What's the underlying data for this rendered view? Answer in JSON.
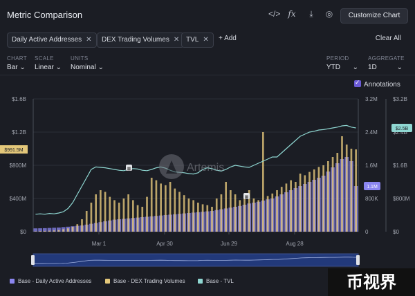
{
  "header": {
    "title": "Metric Comparison",
    "icons": [
      "code-icon",
      "formula-icon",
      "download-icon",
      "camera-icon"
    ],
    "customize_label": "Customize Chart"
  },
  "chips": [
    {
      "label": "Daily Active Addresses"
    },
    {
      "label": "DEX Trading Volumes"
    },
    {
      "label": "TVL"
    }
  ],
  "add_label": "+ Add",
  "clear_label": "Clear All",
  "controls": {
    "chart": {
      "label": "CHART",
      "value": "Bar"
    },
    "scale": {
      "label": "SCALE",
      "value": "Linear"
    },
    "units": {
      "label": "UNITS",
      "value": "Nominal"
    },
    "period": {
      "label": "PERIOD",
      "value": "YTD"
    },
    "aggregate": {
      "label": "AGGREGATE",
      "value": "1D"
    }
  },
  "annotations_label": "Annotations",
  "watermark": "币视界",
  "logo_text": "Artemis",
  "colors": {
    "daa": "#8b86f0",
    "dex": "#e3c77a",
    "tvl": "#8fd7d2",
    "bg": "#1b1d24"
  },
  "chart_data": {
    "type": "bar",
    "x_ticks": [
      "Mar 1",
      "Apr 30",
      "Jun 29",
      "Aug 28"
    ],
    "left_axis": {
      "ticks": [
        "$0",
        "$400M",
        "$800M",
        "$1.2B",
        "$1.6B"
      ],
      "max": 1600000000
    },
    "mid_axis": {
      "ticks": [
        "0",
        "800K",
        "1.6M",
        "2.4M",
        "3.2M"
      ],
      "max": 3200000
    },
    "right_axis": {
      "ticks": [
        "$0",
        "$800M",
        "$1.6B",
        "$2.4B",
        "$3.2B"
      ],
      "max": 3200000000
    },
    "markers": {
      "dex": "$991.5M",
      "daa": "1.1M",
      "tvl": "$2.5B"
    },
    "series": [
      {
        "name": "Base - Daily Active Addresses",
        "axis": "mid",
        "values": [
          80000,
          82000,
          85000,
          90000,
          95000,
          100000,
          110000,
          120000,
          130000,
          140000,
          150000,
          170000,
          190000,
          210000,
          230000,
          250000,
          270000,
          290000,
          300000,
          310000,
          320000,
          330000,
          340000,
          350000,
          360000,
          370000,
          380000,
          390000,
          400000,
          410000,
          420000,
          430000,
          440000,
          450000,
          460000,
          470000,
          480000,
          490000,
          500000,
          520000,
          540000,
          560000,
          580000,
          600000,
          620000,
          650000,
          680000,
          700000,
          720000,
          750000,
          780000,
          800000,
          850000,
          900000,
          950000,
          1000000,
          1050000,
          1100000,
          1150000,
          1200000,
          1250000,
          1300000,
          1350000,
          1450000,
          1550000,
          1650000,
          1750000,
          1800000,
          1700000,
          1100000
        ]
      },
      {
        "name": "Base - DEX Trading Volumes",
        "axis": "left",
        "values": [
          5000000,
          8000000,
          10000000,
          12000000,
          15000000,
          20000000,
          30000000,
          40000000,
          60000000,
          90000000,
          150000000,
          250000000,
          350000000,
          450000000,
          500000000,
          480000000,
          420000000,
          380000000,
          350000000,
          400000000,
          450000000,
          380000000,
          320000000,
          300000000,
          420000000,
          650000000,
          620000000,
          580000000,
          560000000,
          600000000,
          520000000,
          480000000,
          440000000,
          400000000,
          380000000,
          350000000,
          330000000,
          320000000,
          300000000,
          400000000,
          450000000,
          600000000,
          500000000,
          450000000,
          380000000,
          420000000,
          500000000,
          400000000,
          380000000,
          1200000000,
          430000000,
          460000000,
          500000000,
          540000000,
          580000000,
          620000000,
          600000000,
          700000000,
          680000000,
          720000000,
          750000000,
          780000000,
          800000000,
          850000000,
          900000000,
          950000000,
          1150000000,
          1050000000,
          1000000000,
          991500000
        ]
      },
      {
        "name": "Base - TVL",
        "axis": "right",
        "values": [
          420000000,
          430000000,
          420000000,
          440000000,
          430000000,
          450000000,
          480000000,
          560000000,
          700000000,
          900000000,
          1100000000,
          1300000000,
          1500000000,
          1560000000,
          1550000000,
          1540000000,
          1520000000,
          1500000000,
          1480000000,
          1470000000,
          1500000000,
          1520000000,
          1510000000,
          1480000000,
          1470000000,
          1500000000,
          1540000000,
          1560000000,
          1530000000,
          1480000000,
          1440000000,
          1430000000,
          1420000000,
          1400000000,
          1390000000,
          1420000000,
          1500000000,
          1540000000,
          1520000000,
          1480000000,
          1460000000,
          1500000000,
          1560000000,
          1600000000,
          1580000000,
          1560000000,
          1550000000,
          1600000000,
          1650000000,
          1700000000,
          1750000000,
          1800000000,
          1800000000,
          1900000000,
          2000000000,
          2100000000,
          2200000000,
          2300000000,
          2350000000,
          2400000000,
          2420000000,
          2450000000,
          2460000000,
          2480000000,
          2500000000,
          2520000000,
          2550000000,
          2560000000,
          2520000000,
          2500000000
        ]
      }
    ]
  }
}
